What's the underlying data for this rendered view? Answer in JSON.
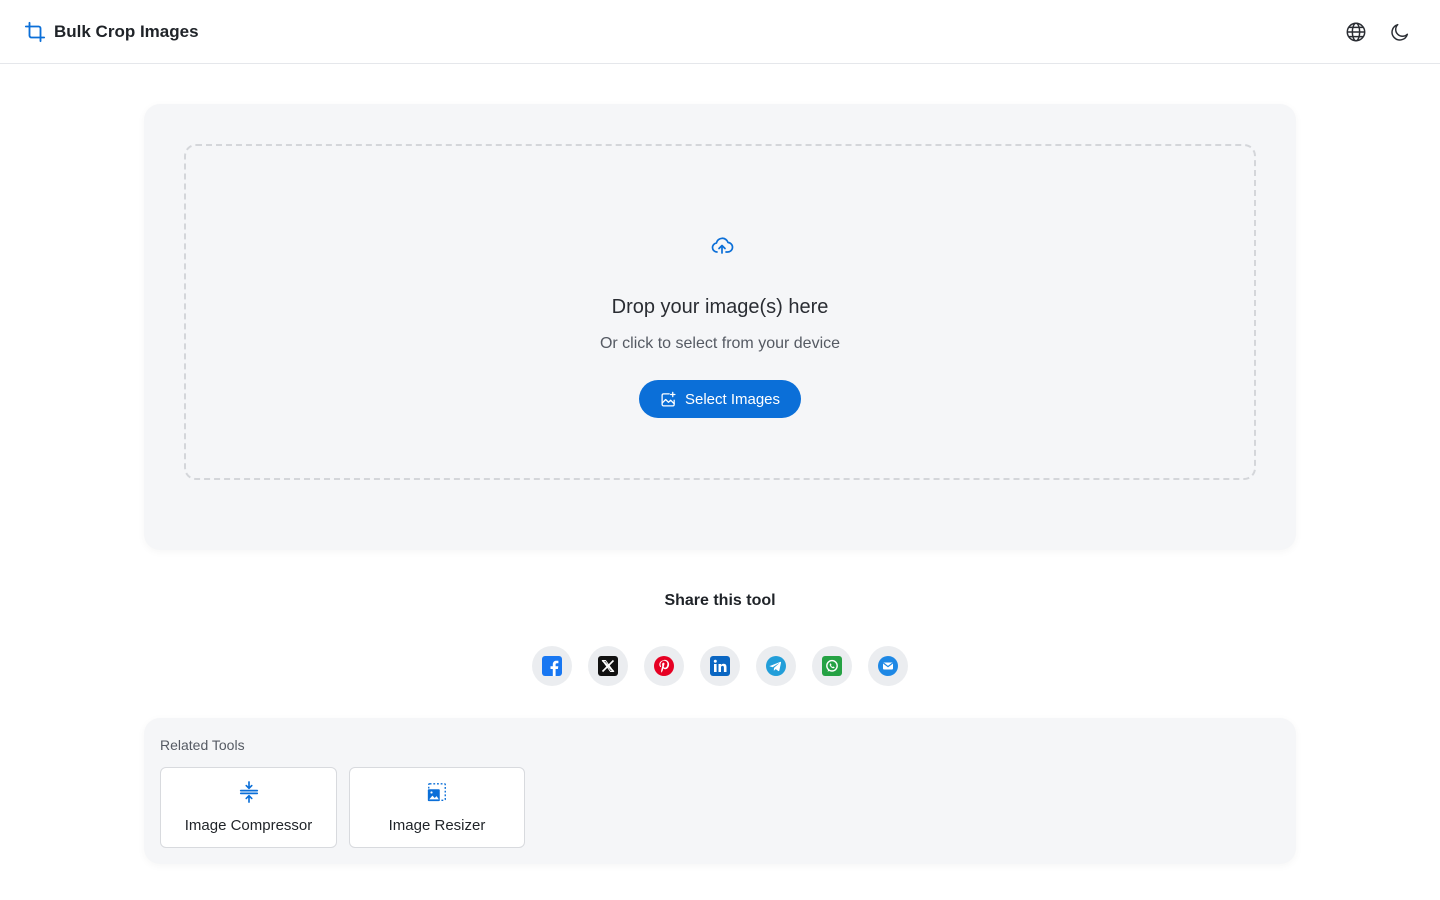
{
  "header": {
    "title": "Bulk Crop Images",
    "brand_icon": "crop-icon",
    "language_icon": "globe-icon",
    "theme_icon": "moon-icon"
  },
  "upload": {
    "icon": "cloud-upload-icon",
    "title": "Drop your image(s) here",
    "subtitle": "Or click to select from your device",
    "button_label": "Select Images",
    "button_icon": "image-add-icon"
  },
  "share": {
    "title": "Share this tool",
    "networks": [
      {
        "name": "facebook",
        "icon": "facebook-icon",
        "color": "#1877f2"
      },
      {
        "name": "x",
        "icon": "x-icon",
        "color": "#111111"
      },
      {
        "name": "pinterest",
        "icon": "pinterest-icon",
        "color": "#e60023"
      },
      {
        "name": "linkedin",
        "icon": "linkedin-icon",
        "color": "#0a66c2"
      },
      {
        "name": "telegram",
        "icon": "telegram-icon",
        "color": "#229ed9"
      },
      {
        "name": "whatsapp",
        "icon": "whatsapp-icon",
        "color": "#25d366"
      },
      {
        "name": "email",
        "icon": "email-icon",
        "color": "#1e88e5"
      }
    ]
  },
  "related": {
    "title": "Related Tools",
    "tools": [
      {
        "label": "Image Compressor",
        "icon": "compress-icon"
      },
      {
        "label": "Image Resizer",
        "icon": "resize-icon"
      }
    ]
  },
  "colors": {
    "accent": "#0b6fd8",
    "panel": "#f5f6f8"
  }
}
